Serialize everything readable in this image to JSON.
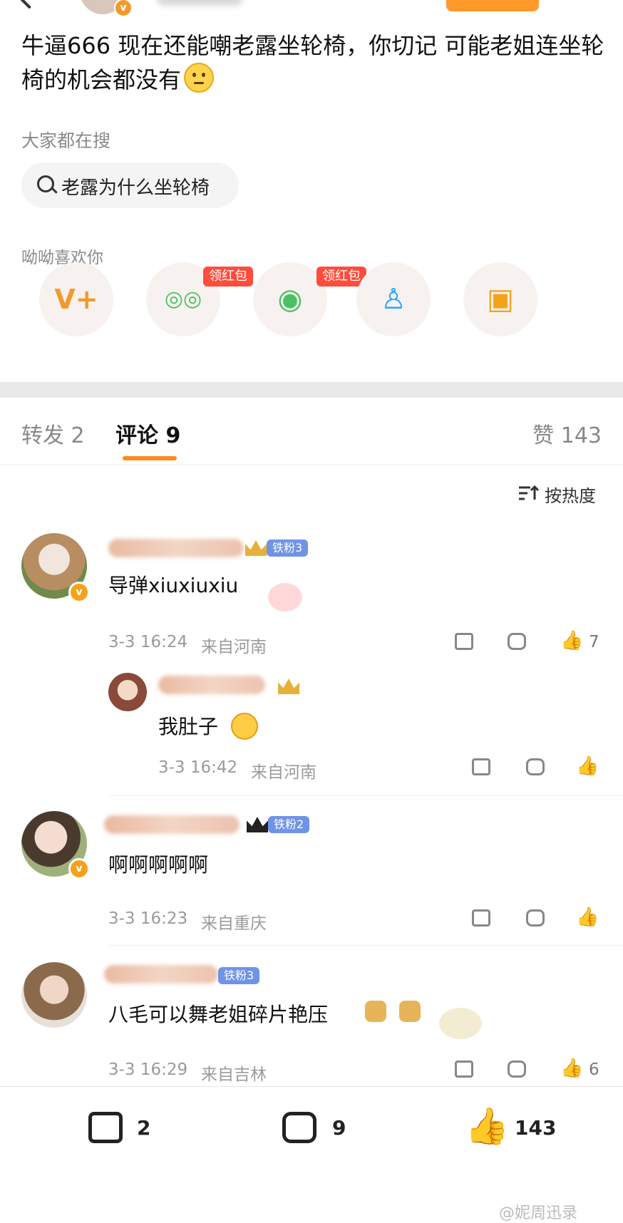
{
  "post": {
    "text": "牛逼666 现在还能嘲老露坐轮椅，你切记 可能老姐连坐轮椅的机会都没有",
    "emoji": "thinking-face"
  },
  "search": {
    "label": "大家都在搜",
    "query": "老露为什么坐轮椅"
  },
  "share": {
    "label": "呦呦喜欢你",
    "targets": [
      {
        "name": "vplus",
        "glyph": "V+",
        "badge": "",
        "color": "#f39a2d"
      },
      {
        "name": "wechat",
        "glyph": "◎◎",
        "badge": "领红包",
        "color": "#48c160"
      },
      {
        "name": "moments",
        "glyph": "◉",
        "badge": "领红包",
        "color": "#48c160"
      },
      {
        "name": "qq",
        "glyph": "♙",
        "badge": "",
        "color": "#2ea6ff"
      },
      {
        "name": "save-image",
        "glyph": "▣",
        "badge": "",
        "color": "#f3a21a"
      }
    ]
  },
  "tabs": {
    "repost": "转发 2",
    "comment": "评论 9",
    "like": "赞 143"
  },
  "sort": {
    "label": "按热度",
    "icon": "sort-icon"
  },
  "comments": [
    {
      "text": "导弹xiuxiuxiu",
      "badge": "铁粉3",
      "time": "3-3 16:24",
      "location": "来自河南",
      "likes": "7",
      "verified": "v"
    },
    {
      "text": "我肚子",
      "badge": "",
      "time": "3-3 16:42",
      "location": "来自河南",
      "likes": "",
      "verified": ""
    },
    {
      "text": "啊啊啊啊啊",
      "badge": "铁粉2",
      "time": "3-3 16:23",
      "location": "来自重庆",
      "likes": "",
      "verified": "v"
    },
    {
      "text": "八毛可以舞老姐碎片艳压",
      "badge": "铁粉3",
      "time": "3-3 16:29",
      "location": "来自吉林",
      "likes": "6",
      "verified": ""
    }
  ],
  "bottom": {
    "repost_count": "2",
    "comment_count": "9",
    "like_count": "143"
  },
  "watermark": "@妮周迅录",
  "colors": {
    "accent": "#ff8a1f",
    "redbag": "#ff4c3b",
    "fanbadge": "#6f93e6"
  }
}
